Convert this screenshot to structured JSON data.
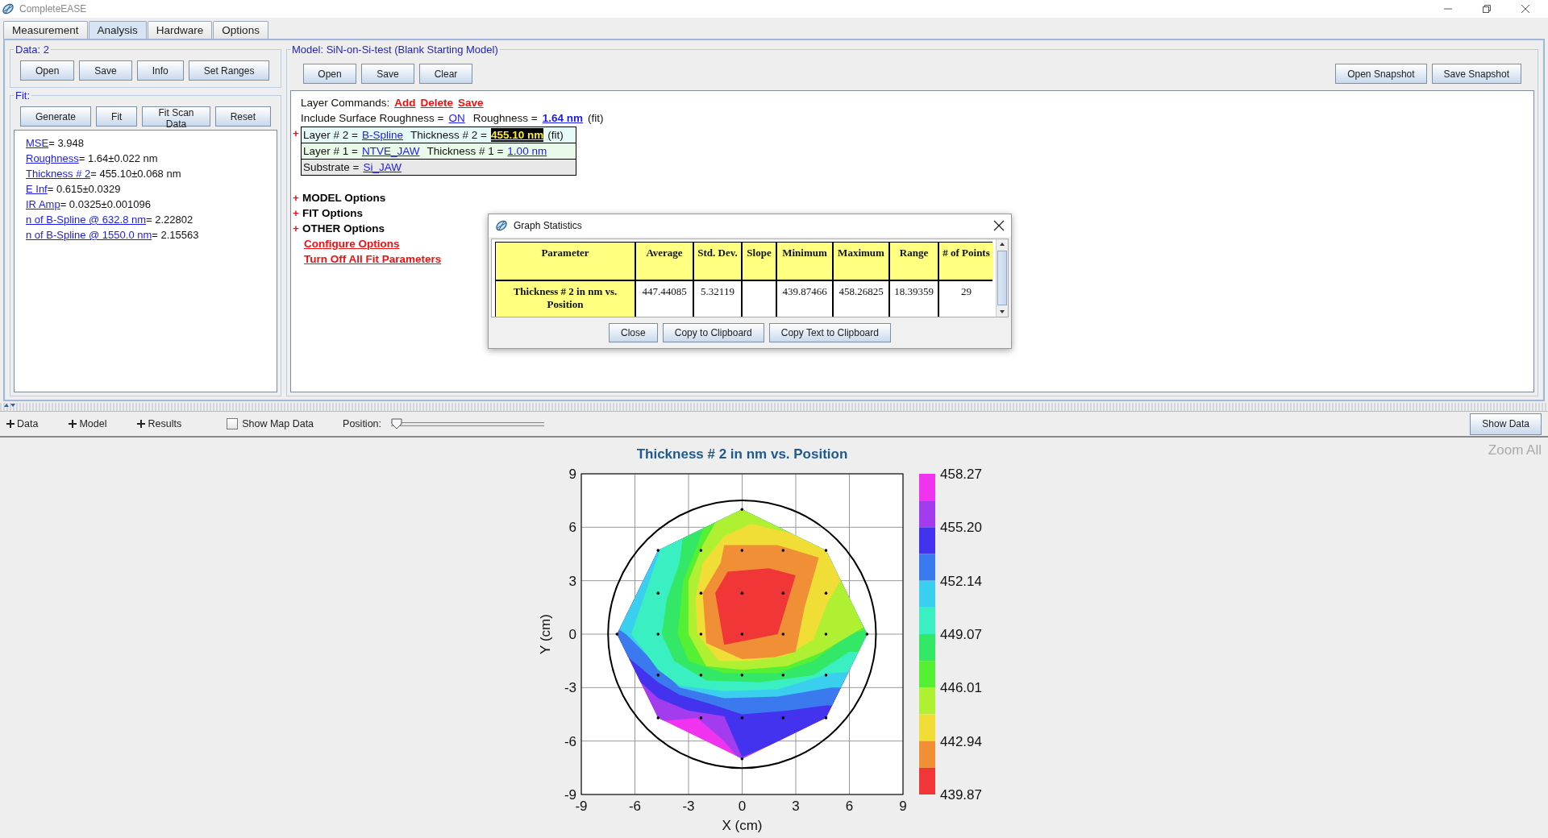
{
  "window": {
    "title": "CompleteEASE"
  },
  "tabs": [
    {
      "label": "Measurement",
      "selected": false
    },
    {
      "label": "Analysis",
      "selected": true
    },
    {
      "label": "Hardware",
      "selected": false
    },
    {
      "label": "Options",
      "selected": false
    }
  ],
  "data_panel": {
    "title": "Data: 2",
    "buttons": [
      "Open",
      "Save",
      "Info",
      "Set Ranges"
    ]
  },
  "fit_panel": {
    "title": "Fit:",
    "buttons": [
      "Generate",
      "Fit",
      "Fit Scan Data",
      "Reset"
    ],
    "results": [
      {
        "name": "MSE",
        "value": "= 3.948"
      },
      {
        "name": "Roughness",
        "value": "= 1.64±0.022 nm"
      },
      {
        "name": "Thickness # 2",
        "value": "= 455.10±0.068 nm"
      },
      {
        "name": "E Inf",
        "value": "= 0.615±0.0329"
      },
      {
        "name": "IR Amp",
        "value": "= 0.0325±0.001096"
      },
      {
        "name": "n of B-Spline @ 632.8 nm",
        "value": "= 2.22802"
      },
      {
        "name": "n of B-Spline @ 1550.0 nm",
        "value": "= 2.15563"
      }
    ]
  },
  "model_panel": {
    "title": "Model: SiN-on-Si-test (Blank Starting Model)",
    "buttons": [
      "Open",
      "Save",
      "Clear"
    ],
    "snapshot_buttons": [
      "Open Snapshot",
      "Save Snapshot"
    ],
    "layer_commands": {
      "label": "Layer Commands:",
      "links": [
        "Add",
        "Delete",
        "Save"
      ]
    },
    "roughness": {
      "label": "Include Surface Roughness =",
      "state": "ON",
      "value_label": "Roughness =",
      "value": "1.64 nm",
      "suffix": "(fit)"
    },
    "layers": [
      {
        "marker": "+",
        "label": "Layer # 2 =",
        "material": "B-Spline",
        "thickness_label": "Thickness # 2 =",
        "thickness": "455.10 nm",
        "highlighted": true,
        "suffix": "(fit)",
        "color": "#e6fafa"
      },
      {
        "label": "Layer # 1 =",
        "material": "NTVE_JAW",
        "thickness_label": "Thickness # 1 =",
        "thickness": "1.00 nm",
        "color": "#eafaea"
      },
      {
        "label": "Substrate =",
        "material": "Si_JAW",
        "color": "#e8e8e8"
      }
    ],
    "options": [
      {
        "marker": "+",
        "label": "MODEL Options"
      },
      {
        "marker": "+",
        "label": "FIT Options"
      },
      {
        "marker": "+",
        "label": "OTHER Options"
      }
    ],
    "option_links": [
      "Configure Options",
      "Turn Off All Fit Parameters"
    ]
  },
  "dialog": {
    "title": "Graph Statistics",
    "columns": [
      "Parameter",
      "Average",
      "Std. Dev.",
      "Slope",
      "Minimum",
      "Maximum",
      "Range",
      "# of Points"
    ],
    "rows": [
      [
        "Thickness # 2 in nm vs. Position",
        "447.44085",
        "5.32119",
        "",
        "439.87466",
        "458.26825",
        "18.39359",
        "29"
      ]
    ],
    "buttons": [
      "Close",
      "Copy to Clipboard",
      "Copy Text to Clipboard"
    ]
  },
  "toolbar": {
    "items": [
      "Data",
      "Model",
      "Results"
    ],
    "show_map_data": {
      "label": "Show Map Data",
      "checked": false
    },
    "position": {
      "label": "Position:",
      "level": 0
    },
    "show_data_button": "Show Data",
    "zoom_all": "Zoom All"
  },
  "plot": {
    "title": "Thickness # 2 in nm vs. Position",
    "xlabel": "X (cm)",
    "ylabel": "Y (cm)",
    "xticks": [
      "-9",
      "-6",
      "-3",
      "0",
      "3",
      "6",
      "9"
    ],
    "yticks": [
      "9",
      "6",
      "3",
      "0",
      "-3",
      "-6",
      "-9"
    ],
    "colorbar": {
      "labels": [
        "458.27",
        "455.20",
        "452.14",
        "449.07",
        "446.01",
        "442.94",
        "439.87"
      ],
      "bands": [
        {
          "color": "#f033ee"
        },
        {
          "color": "#a33cee"
        },
        {
          "color": "#4433ee"
        },
        {
          "color": "#3a7aee"
        },
        {
          "color": "#3acfee"
        },
        {
          "color": "#3af0c3"
        },
        {
          "color": "#33e866"
        },
        {
          "color": "#55f033"
        },
        {
          "color": "#b0f033"
        },
        {
          "color": "#f0de36"
        },
        {
          "color": "#f08f36"
        },
        {
          "color": "#f03636"
        }
      ]
    }
  }
}
